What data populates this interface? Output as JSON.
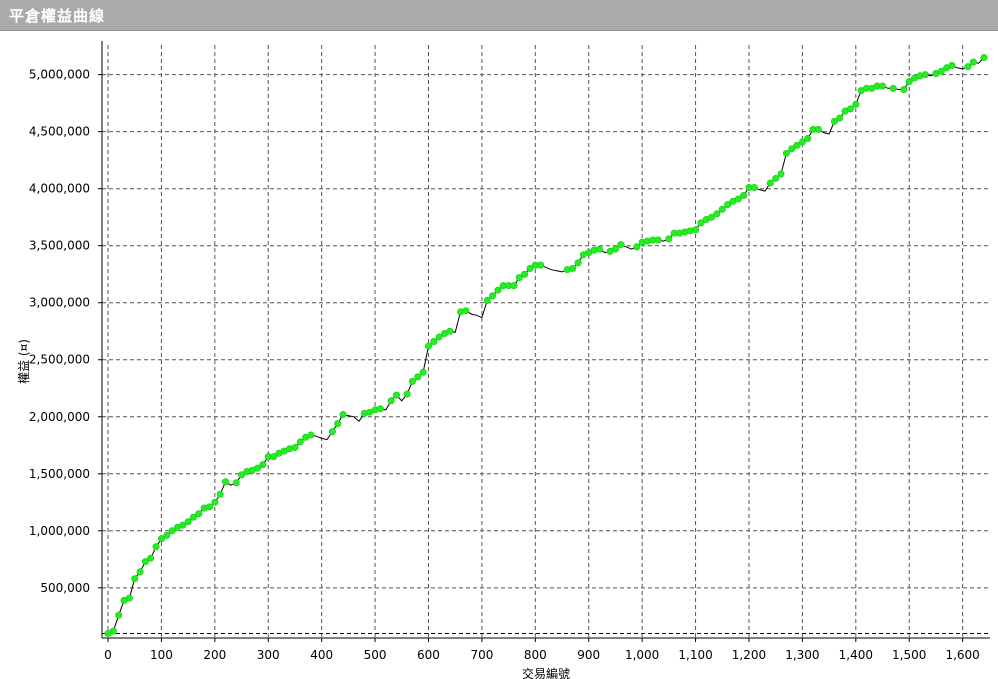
{
  "window": {
    "title": "平倉權益曲線"
  },
  "colors": {
    "point": "#22ee22",
    "line": "#000000",
    "grid": "#555555",
    "title_bar": "#aaaaaa"
  },
  "chart_data": {
    "type": "line",
    "title": "",
    "xlabel": "交易編號",
    "ylabel": "權益 (¤)",
    "xlim": [
      0,
      1640
    ],
    "ylim": [
      60000,
      5260000
    ],
    "x_ticks": [
      0,
      100,
      200,
      300,
      400,
      500,
      600,
      700,
      800,
      900,
      1000,
      1100,
      1200,
      1300,
      1400,
      1500,
      1600
    ],
    "x_tick_labels": [
      "0",
      "100",
      "200",
      "300",
      "400",
      "500",
      "600",
      "700",
      "800",
      "900",
      "1,000",
      "1,100",
      "1,200",
      "1,300",
      "1,400",
      "1,500",
      "1,600"
    ],
    "y_ticks": [
      500000,
      1000000,
      1500000,
      2000000,
      2500000,
      3000000,
      3500000,
      4000000,
      4500000,
      5000000
    ],
    "y_tick_labels": [
      "500,000",
      "1,000,000",
      "1,500,000",
      "2,000,000",
      "2,500,000",
      "3,000,000",
      "3,500,000",
      "4,000,000",
      "4,500,000",
      "5,000,000"
    ],
    "baseline": 100000,
    "grid": true,
    "series": [
      {
        "points": [
          [
            0,
            100000
          ],
          [
            10,
            120000
          ],
          [
            20,
            260000
          ],
          [
            30,
            390000
          ],
          [
            40,
            410000
          ],
          [
            50,
            580000
          ],
          [
            60,
            640000
          ],
          [
            70,
            730000
          ],
          [
            80,
            760000
          ],
          [
            90,
            860000
          ],
          [
            100,
            930000
          ],
          [
            110,
            960000
          ],
          [
            120,
            1000000
          ],
          [
            130,
            1030000
          ],
          [
            140,
            1050000
          ],
          [
            150,
            1080000
          ],
          [
            160,
            1120000
          ],
          [
            170,
            1150000
          ],
          [
            180,
            1200000
          ],
          [
            190,
            1210000
          ],
          [
            200,
            1250000
          ],
          [
            210,
            1320000
          ],
          [
            220,
            1430000
          ],
          [
            230,
            1400000
          ],
          [
            240,
            1420000
          ],
          [
            250,
            1490000
          ],
          [
            260,
            1520000
          ],
          [
            270,
            1530000
          ],
          [
            280,
            1550000
          ],
          [
            290,
            1580000
          ],
          [
            300,
            1650000
          ],
          [
            310,
            1650000
          ],
          [
            320,
            1680000
          ],
          [
            330,
            1700000
          ],
          [
            340,
            1720000
          ],
          [
            350,
            1730000
          ],
          [
            360,
            1780000
          ],
          [
            370,
            1820000
          ],
          [
            380,
            1840000
          ],
          [
            390,
            1830000
          ],
          [
            400,
            1810000
          ],
          [
            410,
            1800000
          ],
          [
            420,
            1870000
          ],
          [
            430,
            1940000
          ],
          [
            440,
            2020000
          ],
          [
            450,
            2010000
          ],
          [
            460,
            2000000
          ],
          [
            470,
            1960000
          ],
          [
            480,
            2030000
          ],
          [
            490,
            2040000
          ],
          [
            500,
            2060000
          ],
          [
            510,
            2070000
          ],
          [
            520,
            2060000
          ],
          [
            530,
            2140000
          ],
          [
            540,
            2190000
          ],
          [
            550,
            2140000
          ],
          [
            560,
            2200000
          ],
          [
            570,
            2310000
          ],
          [
            580,
            2350000
          ],
          [
            590,
            2390000
          ],
          [
            600,
            2620000
          ],
          [
            610,
            2660000
          ],
          [
            620,
            2700000
          ],
          [
            630,
            2730000
          ],
          [
            640,
            2750000
          ],
          [
            650,
            2740000
          ],
          [
            660,
            2920000
          ],
          [
            670,
            2930000
          ],
          [
            680,
            2900000
          ],
          [
            690,
            2890000
          ],
          [
            700,
            2870000
          ],
          [
            710,
            3020000
          ],
          [
            720,
            3060000
          ],
          [
            730,
            3110000
          ],
          [
            740,
            3150000
          ],
          [
            750,
            3150000
          ],
          [
            760,
            3150000
          ],
          [
            770,
            3220000
          ],
          [
            780,
            3250000
          ],
          [
            790,
            3300000
          ],
          [
            800,
            3330000
          ],
          [
            810,
            3330000
          ],
          [
            820,
            3310000
          ],
          [
            830,
            3290000
          ],
          [
            840,
            3280000
          ],
          [
            850,
            3270000
          ],
          [
            860,
            3290000
          ],
          [
            870,
            3300000
          ],
          [
            880,
            3350000
          ],
          [
            890,
            3420000
          ],
          [
            900,
            3440000
          ],
          [
            910,
            3460000
          ],
          [
            920,
            3470000
          ],
          [
            930,
            3440000
          ],
          [
            940,
            3450000
          ],
          [
            950,
            3470000
          ],
          [
            960,
            3510000
          ],
          [
            970,
            3490000
          ],
          [
            980,
            3470000
          ],
          [
            990,
            3490000
          ],
          [
            1000,
            3530000
          ],
          [
            1010,
            3540000
          ],
          [
            1020,
            3550000
          ],
          [
            1030,
            3550000
          ],
          [
            1040,
            3540000
          ],
          [
            1050,
            3560000
          ],
          [
            1060,
            3610000
          ],
          [
            1070,
            3610000
          ],
          [
            1080,
            3620000
          ],
          [
            1090,
            3630000
          ],
          [
            1100,
            3640000
          ],
          [
            1110,
            3700000
          ],
          [
            1120,
            3730000
          ],
          [
            1130,
            3750000
          ],
          [
            1140,
            3780000
          ],
          [
            1150,
            3820000
          ],
          [
            1160,
            3860000
          ],
          [
            1170,
            3890000
          ],
          [
            1180,
            3910000
          ],
          [
            1190,
            3940000
          ],
          [
            1200,
            4010000
          ],
          [
            1210,
            4010000
          ],
          [
            1220,
            3990000
          ],
          [
            1230,
            3980000
          ],
          [
            1240,
            4050000
          ],
          [
            1250,
            4090000
          ],
          [
            1260,
            4130000
          ],
          [
            1270,
            4310000
          ],
          [
            1280,
            4350000
          ],
          [
            1290,
            4380000
          ],
          [
            1300,
            4410000
          ],
          [
            1310,
            4440000
          ],
          [
            1320,
            4520000
          ],
          [
            1330,
            4520000
          ],
          [
            1340,
            4490000
          ],
          [
            1350,
            4480000
          ],
          [
            1360,
            4590000
          ],
          [
            1370,
            4620000
          ],
          [
            1380,
            4680000
          ],
          [
            1390,
            4700000
          ],
          [
            1400,
            4740000
          ],
          [
            1410,
            4860000
          ],
          [
            1420,
            4880000
          ],
          [
            1430,
            4880000
          ],
          [
            1440,
            4900000
          ],
          [
            1450,
            4900000
          ],
          [
            1460,
            4880000
          ],
          [
            1470,
            4880000
          ],
          [
            1480,
            4870000
          ],
          [
            1490,
            4870000
          ],
          [
            1500,
            4940000
          ],
          [
            1510,
            4970000
          ],
          [
            1520,
            4990000
          ],
          [
            1530,
            5000000
          ],
          [
            1540,
            4990000
          ],
          [
            1550,
            5010000
          ],
          [
            1560,
            5030000
          ],
          [
            1570,
            5060000
          ],
          [
            1580,
            5080000
          ],
          [
            1590,
            5060000
          ],
          [
            1600,
            5050000
          ],
          [
            1610,
            5070000
          ],
          [
            1620,
            5110000
          ],
          [
            1630,
            5100000
          ],
          [
            1640,
            5150000
          ]
        ]
      }
    ]
  }
}
